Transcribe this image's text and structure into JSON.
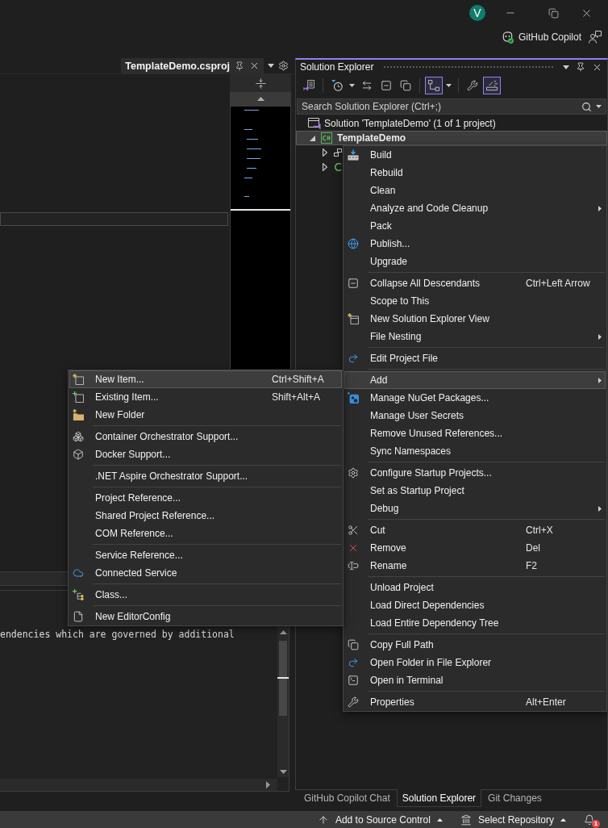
{
  "title_bar": {
    "account_initial": "V",
    "copilot_label": "GitHub Copilot"
  },
  "editor": {
    "tab": {
      "label": "TemplateDemo.csproj",
      "selected": true
    },
    "output_lines": [
      "endencies which are governed by additional"
    ]
  },
  "solution_explorer": {
    "title": "Solution Explorer",
    "toolbar": [
      [
        {
          "kind": "views",
          "on": false
        }
      ],
      [
        {
          "kind": "history",
          "on": false
        },
        {
          "kind": "dropdown",
          "on": false
        },
        {
          "kind": "sync",
          "on": false
        },
        {
          "kind": "collapse",
          "on": false
        },
        {
          "kind": "copy",
          "on": false
        }
      ],
      [
        {
          "kind": "tree",
          "on": true
        },
        {
          "kind": "dropdown",
          "on": false
        }
      ],
      [
        {
          "kind": "properties",
          "on": false
        },
        {
          "kind": "preview",
          "on": true
        }
      ]
    ],
    "search": {
      "placeholder": "Search Solution Explorer (Ctrl+;)"
    },
    "tree": [
      {
        "kind": "solution",
        "label": "Solution 'TemplateDemo' (1 of 1 project)",
        "selected": false,
        "startup": false,
        "children": [
          {
            "kind": "project",
            "label": "TemplateDemo",
            "selected": true,
            "startup": true,
            "expanded": true,
            "children": [
              {
                "kind": "dependencies",
                "selected": false,
                "expanded": false
              },
              {
                "kind": "code",
                "selected": false,
                "expanded": false
              }
            ]
          }
        ]
      }
    ]
  },
  "panel_tabs": [
    {
      "label": "GitHub Copilot Chat",
      "selected": false
    },
    {
      "label": "Solution Explorer",
      "selected": true
    },
    {
      "label": "Git Changes",
      "selected": false
    }
  ],
  "context_menu": {
    "groups": [
      [
        {
          "kind": "build",
          "label": "Build",
          "submenu": false,
          "selected": false
        },
        {
          "kind": "text",
          "label": "Rebuild",
          "submenu": false,
          "selected": false
        },
        {
          "kind": "text",
          "label": "Clean",
          "submenu": false,
          "selected": false
        },
        {
          "kind": "text",
          "label": "Analyze and Code Cleanup",
          "submenu": true,
          "selected": false
        },
        {
          "kind": "text",
          "label": "Pack",
          "submenu": false,
          "selected": false
        },
        {
          "kind": "publish",
          "label": "Publish...",
          "submenu": false,
          "selected": false
        },
        {
          "kind": "text",
          "label": "Upgrade",
          "submenu": false,
          "selected": false
        }
      ],
      [
        {
          "kind": "collapse",
          "label": "Collapse All Descendants",
          "shortcut": "Ctrl+Left Arrow",
          "submenu": false,
          "selected": false
        },
        {
          "kind": "text",
          "label": "Scope to This",
          "submenu": false,
          "selected": false
        },
        {
          "kind": "new-view",
          "label": "New Solution Explorer View",
          "submenu": false,
          "selected": false
        },
        {
          "kind": "text",
          "label": "File Nesting",
          "submenu": true,
          "selected": false
        }
      ],
      [
        {
          "kind": "edit",
          "label": "Edit Project File",
          "submenu": false,
          "selected": false
        }
      ],
      [
        {
          "kind": "text",
          "label": "Add",
          "submenu": true,
          "selected": true
        },
        {
          "kind": "nuget",
          "label": "Manage NuGet Packages...",
          "submenu": false,
          "selected": false
        },
        {
          "kind": "text",
          "label": "Manage User Secrets",
          "submenu": false,
          "selected": false
        },
        {
          "kind": "text",
          "label": "Remove Unused References...",
          "submenu": false,
          "selected": false
        },
        {
          "kind": "text",
          "label": "Sync Namespaces",
          "submenu": false,
          "selected": false
        }
      ],
      [
        {
          "kind": "configure",
          "label": "Configure Startup Projects...",
          "submenu": false,
          "selected": false
        },
        {
          "kind": "text",
          "label": "Set as Startup Project",
          "submenu": false,
          "selected": false
        },
        {
          "kind": "text",
          "label": "Debug",
          "submenu": true,
          "selected": false
        }
      ],
      [
        {
          "kind": "cut",
          "label": "Cut",
          "shortcut": "Ctrl+X",
          "submenu": false,
          "selected": false
        },
        {
          "kind": "remove",
          "label": "Remove",
          "shortcut": "Del",
          "submenu": false,
          "selected": false
        },
        {
          "kind": "rename",
          "label": "Rename",
          "shortcut": "F2",
          "submenu": false,
          "selected": false
        }
      ],
      [
        {
          "kind": "text",
          "label": "Unload Project",
          "submenu": false,
          "selected": false
        },
        {
          "kind": "text",
          "label": "Load Direct Dependencies",
          "submenu": false,
          "selected": false
        },
        {
          "kind": "text",
          "label": "Load Entire Dependency Tree",
          "submenu": false,
          "selected": false
        }
      ],
      [
        {
          "kind": "copy",
          "label": "Copy Full Path",
          "submenu": false,
          "selected": false
        },
        {
          "kind": "open-folder",
          "label": "Open Folder in File Explorer",
          "submenu": false,
          "selected": false
        },
        {
          "kind": "terminal",
          "label": "Open in Terminal",
          "submenu": false,
          "selected": false
        }
      ],
      [
        {
          "kind": "properties",
          "label": "Properties",
          "shortcut": "Alt+Enter",
          "submenu": false,
          "selected": false
        }
      ]
    ]
  },
  "add_submenu": {
    "groups": [
      [
        {
          "kind": "new-item",
          "label": "New Item...",
          "shortcut": "Ctrl+Shift+A",
          "submenu": false,
          "selected": true
        },
        {
          "kind": "existing-item",
          "label": "Existing Item...",
          "shortcut": "Shift+Alt+A",
          "submenu": false,
          "selected": false
        },
        {
          "kind": "new-folder",
          "label": "New Folder",
          "submenu": false,
          "selected": false
        }
      ],
      [
        {
          "kind": "containers",
          "label": "Container Orchestrator Support...",
          "submenu": false,
          "selected": false
        },
        {
          "kind": "docker",
          "label": "Docker Support...",
          "submenu": false,
          "selected": false
        }
      ],
      [
        {
          "kind": "text",
          "label": ".NET Aspire Orchestrator Support...",
          "submenu": false,
          "selected": false
        }
      ],
      [
        {
          "kind": "text",
          "label": "Project Reference...",
          "submenu": false,
          "selected": false
        },
        {
          "kind": "text",
          "label": "Shared Project Reference...",
          "submenu": false,
          "selected": false
        },
        {
          "kind": "text",
          "label": "COM Reference...",
          "submenu": false,
          "selected": false
        }
      ],
      [
        {
          "kind": "text",
          "label": "Service Reference...",
          "submenu": false,
          "selected": false
        },
        {
          "kind": "connected",
          "label": "Connected Service",
          "submenu": false,
          "selected": false
        }
      ],
      [
        {
          "kind": "class",
          "label": "Class...",
          "submenu": false,
          "selected": false
        }
      ],
      [
        {
          "kind": "editorconfig",
          "label": "New EditorConfig",
          "submenu": false,
          "selected": false
        }
      ]
    ]
  },
  "status_bar": {
    "items": [
      {
        "kind": "source-control",
        "label": "Add to Source Control"
      },
      {
        "kind": "repository",
        "label": "Select Repository"
      }
    ],
    "notification_count": "1"
  }
}
